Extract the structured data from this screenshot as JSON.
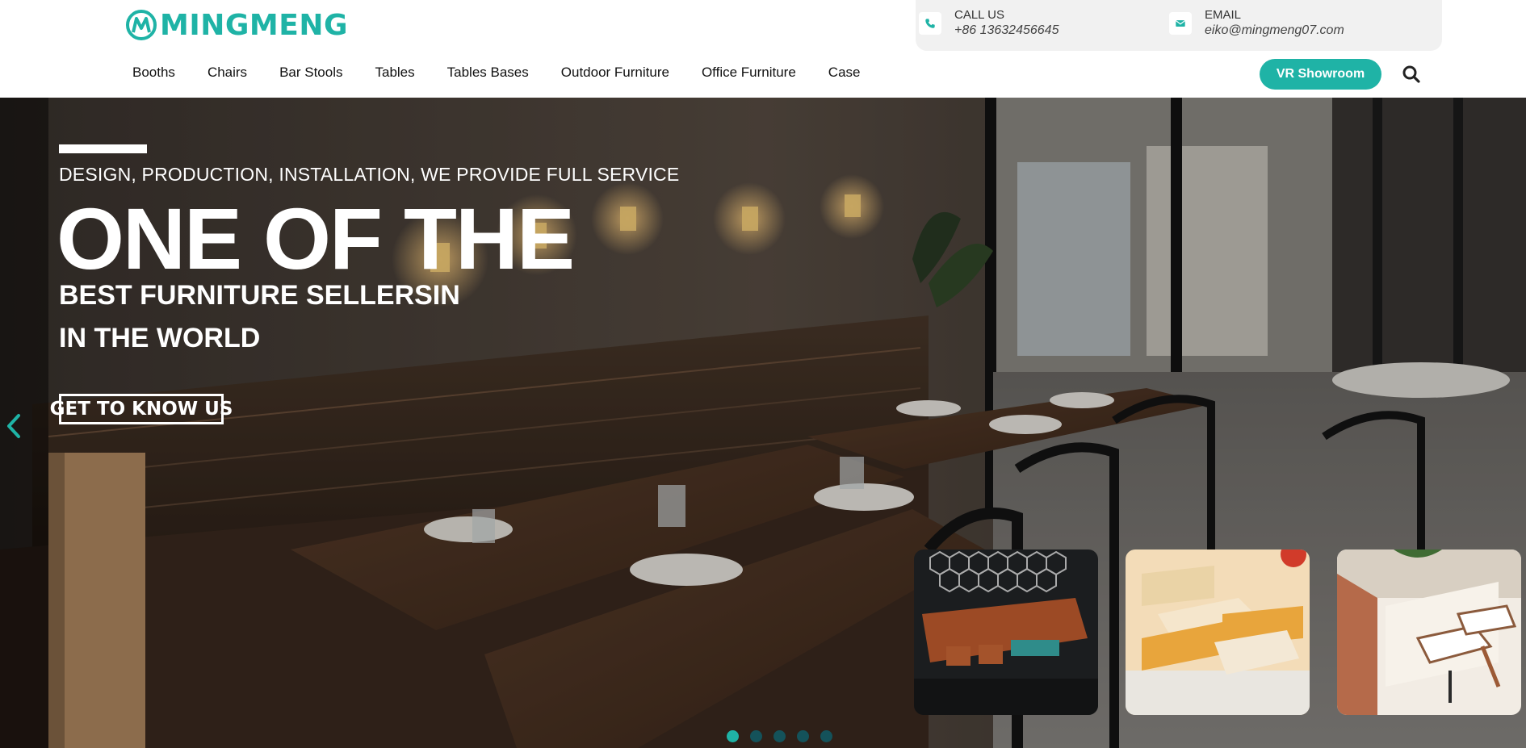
{
  "brand": {
    "name": "MINGMENG",
    "accent": "#1fb3a6"
  },
  "contact": {
    "call": {
      "label": "CALL US",
      "value": "+86 13632456645",
      "icon": "phone-icon"
    },
    "email": {
      "label": "EMAIL",
      "value": "eiko@mingmeng07.com",
      "icon": "envelope-icon"
    }
  },
  "nav": {
    "items": [
      {
        "label": "Booths"
      },
      {
        "label": "Chairs"
      },
      {
        "label": "Bar Stools"
      },
      {
        "label": "Tables"
      },
      {
        "label": "Tables Bases"
      },
      {
        "label": "Outdoor Furniture"
      },
      {
        "label": "Office Furniture"
      },
      {
        "label": "Case"
      }
    ],
    "vr_button": "VR Showroom",
    "search_icon": "search-icon"
  },
  "hero": {
    "subtitle": "DESIGN, PRODUCTION, INSTALLATION, WE PROVIDE FULL SERVICE",
    "title": "ONE OF THE",
    "line1": "BEST FURNITURE SELLERSIN",
    "line2": "IN THE WORLD",
    "cta": "GET TO KNOW US",
    "prev_icon": "chevron-left-icon",
    "slide_count": 5,
    "active_slide": 1
  },
  "thumbnails": [
    {
      "name": "booth-hexagon-lounge"
    },
    {
      "name": "booth-wooden-yellow"
    },
    {
      "name": "booth-cream-restaurant"
    }
  ]
}
